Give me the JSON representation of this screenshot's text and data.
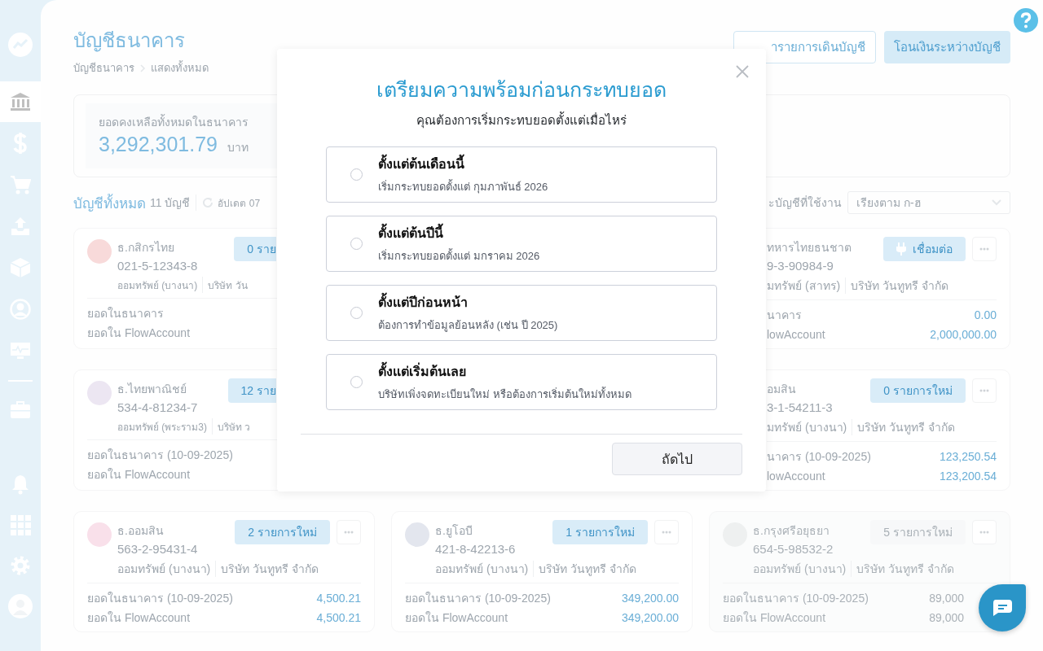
{
  "sidebar": {
    "groups": [
      {
        "items": [
          {
            "kind": "trend",
            "selected": false
          },
          {
            "kind": "bank",
            "selected": true
          },
          {
            "kind": "dollar",
            "selected": false
          },
          {
            "kind": "cart",
            "selected": false
          },
          {
            "kind": "upload",
            "selected": false
          },
          {
            "kind": "box",
            "selected": false
          },
          {
            "kind": "user",
            "selected": false
          },
          {
            "kind": "monitor",
            "selected": false
          }
        ]
      },
      {
        "items": [
          {
            "kind": "briefcase",
            "selected": false
          }
        ]
      }
    ],
    "bottom_items": [
      {
        "kind": "bell"
      },
      {
        "kind": "apps"
      },
      {
        "kind": "gear"
      },
      {
        "kind": "avatar"
      }
    ]
  },
  "header": {
    "title": "บัญชีธนาคาร",
    "breadcrumb": [
      "บัญชีธนาคาร",
      "แสดงทั้งหมด"
    ],
    "buttons": [
      {
        "label": "ารายการเดินบัญชี",
        "kind": "outline"
      },
      {
        "label": "โอนเงินระหว่างบัญชี",
        "kind": "filled"
      }
    ]
  },
  "summary": {
    "label": "ยอดคงเหลือทั้งหมดในธนาคาร",
    "amount": "3,292,301.79",
    "unit": "บาท"
  },
  "accounts_header": {
    "title": "บัญชีทั้งหมด",
    "count": "11 บัญชี",
    "updated": "อัปเดต 07",
    "filter_label": "ะบัญชีที่ใช้งาน",
    "sort": "เรียงตาม ก-ฮ"
  },
  "accounts": [
    {
      "kind": "clipped_left",
      "color": "#f8dada",
      "name": "ธ.กสิกรไทย",
      "number": "021-5-12343-8",
      "type": "ออมทรัพย์ (บางนา)",
      "company": "บริษัท วัน",
      "badge": {
        "kind": "new",
        "label": "0 ราย"
      },
      "rows": [
        {
          "label": "ยอดในธนาคาร"
        },
        {
          "label": "ยอดใน FlowAccount"
        }
      ]
    },
    {
      "kind": "hidden"
    },
    {
      "kind": "clipped_right",
      "name": "ทหารไทยธนชาต",
      "number": "9-3-90984-9",
      "type": "มทรัพย์ (สาทร)",
      "company": "บริษัท วันทูทรี จำกัด",
      "badge": {
        "kind": "connect",
        "label": "เชื่อมต่อ"
      },
      "rows": [
        {
          "label": "นาคาร",
          "value": "0.00"
        },
        {
          "label": "lowAccount",
          "value": "2,000,000.00"
        }
      ]
    },
    {
      "kind": "clipped_left",
      "color": "#ece6f2",
      "name": "ธ.ไทยพาณิชย์",
      "number": "534-4-81234-7",
      "type": "ออมทรัพย์ (พระราม3)",
      "company": "บริษัท ว",
      "badge": {
        "kind": "new",
        "label": "12 ราย"
      },
      "rows": [
        {
          "label": "ยอดในธนาคาร (10-09-2025)"
        },
        {
          "label": "ยอดใน FlowAccount"
        }
      ]
    },
    {
      "kind": "hidden"
    },
    {
      "kind": "clipped_right",
      "name": "อมสิน",
      "number": "3-1-54211-3",
      "type": "มทรัพย์ (บางนา)",
      "company": "บริษัท วันทูทรี จำกัด",
      "badge": {
        "kind": "new",
        "label": "0 รายการใหม่"
      },
      "rows": [
        {
          "label": "นาคาร (10-09-2025)",
          "value": "123,250.54"
        },
        {
          "label": "lowAccount",
          "value": "123,200.54"
        }
      ]
    },
    {
      "kind": "full",
      "color": "#f9e0ea",
      "name": "ธ.ออมสิน",
      "number": "563-2-95431-4",
      "type": "ออมทรัพย์ (บางนา)",
      "company": "บริษัท วันทูทรี จำกัด",
      "badge": {
        "kind": "new",
        "label": "2 รายการใหม่"
      },
      "rows": [
        {
          "label": "ยอดในธนาคาร (10-09-2025)",
          "value": "4,500.21"
        },
        {
          "label": "ยอดใน FlowAccount",
          "value": "4,500.21"
        }
      ]
    },
    {
      "kind": "full",
      "color": "#e3e6ee",
      "name": "ธ.ยูโอบี",
      "number": "421-8-42213-6",
      "type": "ออมทรัพย์ (บางนา)",
      "company": "บริษัท วันทูทรี จำกัด",
      "badge": {
        "kind": "new",
        "label": "1 รายการใหม่"
      },
      "rows": [
        {
          "label": "ยอดในธนาคาร (10-09-2025)",
          "value": "349,200.00"
        },
        {
          "label": "ยอดใน FlowAccount",
          "value": "349,200.00"
        }
      ]
    },
    {
      "kind": "disabled",
      "color": "#eef0f0",
      "name": "ธ.กรุงศรีอยุธยา",
      "number": "654-5-98532-2",
      "type": "ออมทรัพย์ (บางนา)",
      "company": "บริษัท วันทูทรี จำกัด",
      "badge": {
        "kind": "plain",
        "label": "5 รายการใหม่"
      },
      "rows": [
        {
          "label": "ยอดในธนาคาร (10-09-2025)",
          "value": "89,000"
        },
        {
          "label": "ยอดใน FlowAccount",
          "value": "89,000"
        }
      ]
    }
  ],
  "modal": {
    "title": "เตรียมความพร้อมก่อนกระทบยอด",
    "subtitle": "คุณต้องการเริ่มกระทบยอดตั้งแต่เมื่อไหร่",
    "options": [
      {
        "title": "ตั้งแต่ต้นเดือนนี้",
        "description": "เริ่มกระทบยอดตั้งแต่ กุมภาพันธ์ 2026",
        "selected": false
      },
      {
        "title": "ตั้งแต่ต้นปีนี้",
        "description": "เริ่มกระทบยอดตั้งแต่ มกราคม 2026",
        "selected": false
      },
      {
        "title": "ตั้งแต่ปีก่อนหน้า",
        "description": "ต้องการทำข้อมูลย้อนหลัง (เช่น ปี 2025)",
        "selected": false
      },
      {
        "title": "ตั้งแต่เริ่มต้นเลย",
        "description": "บริษัทเพิ่งจดทะเบียนใหม่ หรือต้องการเริ่มต้นใหม่ทั้งหมด",
        "selected": false
      }
    ],
    "next_button": "ถัดไป"
  }
}
